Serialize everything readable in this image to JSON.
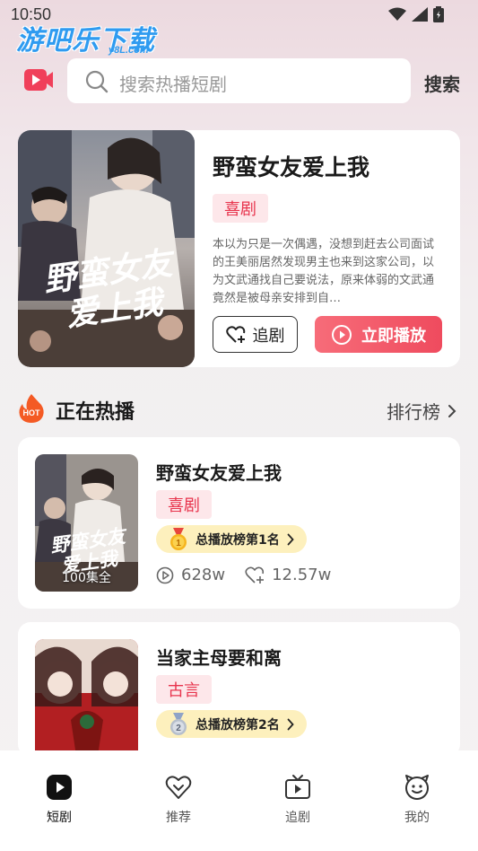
{
  "status_bar": {
    "time": "10:50"
  },
  "watermark": {
    "main": "游吧乐下载",
    "sub": "y8L.com"
  },
  "header": {
    "search_placeholder": "搜索热播短剧",
    "search_button": "搜索"
  },
  "featured": {
    "title": "野蛮女友爱上我",
    "tag": "喜剧",
    "description": "本以为只是一次偶遇，没想到赶去公司面试的王美丽居然发现男主也来到这家公司，以为文武通找自己要说法，原来体弱的文武通竟然是被母亲安排到自…",
    "poster_text_line1": "野蛮女友",
    "poster_text_line2": "爱上我",
    "follow_label": "追剧",
    "play_label": "立即播放"
  },
  "hot_section": {
    "title": "正在热播",
    "rank_link": "排行榜",
    "hot_badge": "HOT"
  },
  "list": [
    {
      "title": "野蛮女友爱上我",
      "tag": "喜剧",
      "rank_text": "总播放榜第1名",
      "rank_number": "1",
      "episodes": "100集全",
      "poster_text_line1": "野蛮女友",
      "poster_text_line2": "爱上我",
      "plays": "628w",
      "follows": "12.57w"
    },
    {
      "title": "当家主母要和离",
      "tag": "古言",
      "rank_text": "总播放榜第2名",
      "rank_number": "2"
    }
  ],
  "bottom_nav": [
    {
      "label": "短剧",
      "icon": "play-square-icon",
      "active": true
    },
    {
      "label": "推荐",
      "icon": "heart-diamond-icon",
      "active": false
    },
    {
      "label": "追剧",
      "icon": "tv-icon",
      "active": false
    },
    {
      "label": "我的",
      "icon": "smiley-icon",
      "active": false
    }
  ],
  "colors": {
    "accent": "#ef4b5e",
    "tag_bg": "#fde7ea",
    "rank_bg": "#fdf0bd",
    "hot_orange": "#f45a24"
  }
}
